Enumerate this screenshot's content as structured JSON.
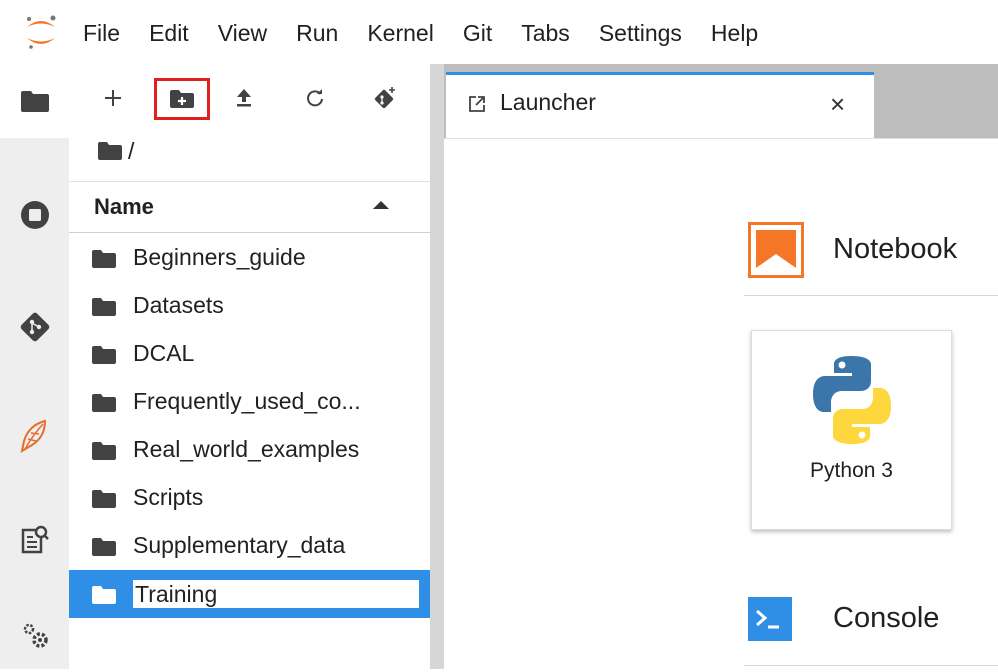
{
  "menubar": {
    "items": [
      "File",
      "Edit",
      "View",
      "Run",
      "Kernel",
      "Git",
      "Tabs",
      "Settings",
      "Help"
    ]
  },
  "activitybar": {
    "icons": [
      "folder-icon",
      "running-icon",
      "git-icon",
      "extension-icon",
      "property-inspector-icon",
      "settings-icon"
    ]
  },
  "filebrowser": {
    "breadcrumb": "/",
    "header": {
      "name_label": "Name"
    },
    "items": [
      {
        "name": "Beginners_guide"
      },
      {
        "name": "Datasets"
      },
      {
        "name": "DCAL"
      },
      {
        "name": "Frequently_used_co..."
      },
      {
        "name": "Real_world_examples"
      },
      {
        "name": "Scripts"
      },
      {
        "name": "Supplementary_data"
      },
      {
        "name": "Training",
        "selected": true
      }
    ]
  },
  "tab": {
    "label": "Launcher",
    "close": "×"
  },
  "launcher": {
    "notebook_title": "Notebook",
    "kernel_label": "Python 3",
    "console_title": "Console"
  },
  "colors": {
    "accent": "#2f8fe6",
    "highlight": "#e0201c",
    "notebook": "#f37726"
  }
}
